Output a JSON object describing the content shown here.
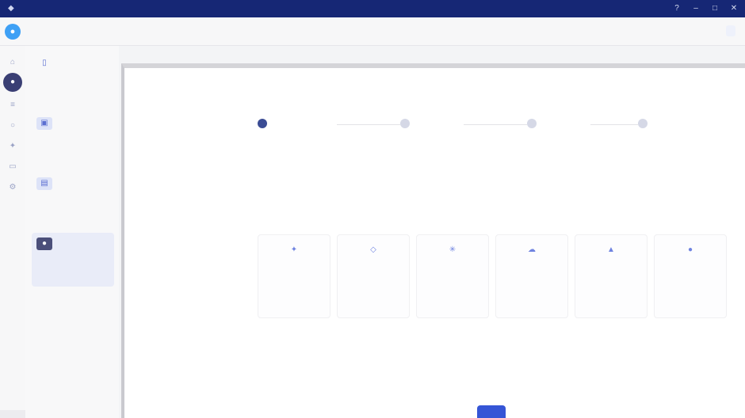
{
  "window": {
    "title": ""
  },
  "header": {
    "app_name": "",
    "action_button": ""
  },
  "breadcrumb": {
    "text": ""
  },
  "center_title": "",
  "sidebar": {
    "items": [
      {
        "title": "",
        "desc": ""
      },
      {
        "title": "",
        "desc": ""
      },
      {
        "title": "",
        "desc": ""
      },
      {
        "title": "",
        "desc": ""
      }
    ]
  },
  "dialog": {
    "label": ""
  },
  "steps": [
    {
      "label": ""
    },
    {
      "label": ""
    },
    {
      "label": ""
    },
    {
      "label": ""
    }
  ],
  "feature_cards": [
    {
      "icon": "star-icon",
      "text": ""
    },
    {
      "icon": "shield-icon",
      "text": ""
    },
    {
      "icon": "gear-icon",
      "text": ""
    },
    {
      "icon": "cloud-icon",
      "text": ""
    },
    {
      "icon": "chart-icon",
      "text": ""
    },
    {
      "icon": "user-icon",
      "text": ""
    }
  ],
  "primary_button": {
    "label": ""
  },
  "colors": {
    "titlebar": "#162775",
    "accent": "#3555d6",
    "active_rail": "#3a3f74"
  }
}
